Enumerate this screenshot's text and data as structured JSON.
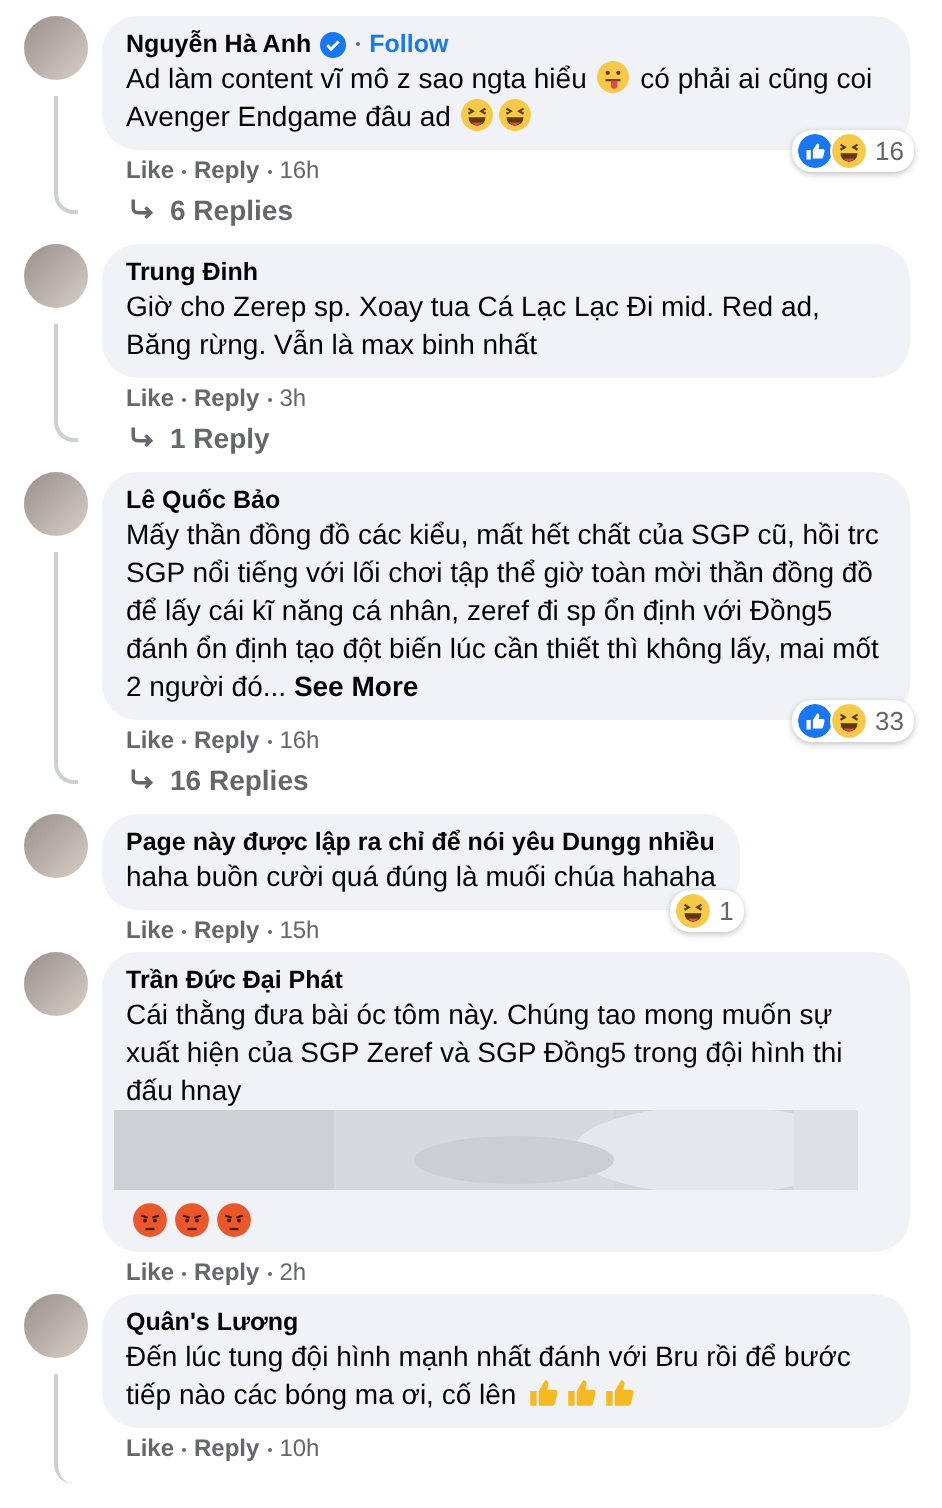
{
  "comments": [
    {
      "author": "Nguyễn Hà Anh",
      "verified": true,
      "follow": "Follow",
      "thread_line": true,
      "body": [
        {
          "kind": "text",
          "text": "Ad làm content vĩ mô z sao ngta hiểu "
        },
        {
          "kind": "tongue"
        },
        {
          "kind": "text",
          "text": " có phải ai cũng coi Avenger Endgame đâu ad "
        },
        {
          "kind": "laugh"
        },
        {
          "kind": "laugh"
        }
      ],
      "reactions": [
        {
          "kind": "like"
        },
        {
          "kind": "haha"
        }
      ],
      "reaction_count": "16",
      "like": "Like",
      "reply": "Reply",
      "time": "16h",
      "replies": "6 Replies"
    },
    {
      "author": "Trung Đinh",
      "thread_line": true,
      "body": [
        {
          "kind": "text",
          "text": "Giờ cho Zerep sp. Xoay tua Cá Lạc Lạc Đi mid. Red ad, Băng rừng. Vẫn là max binh nhất"
        }
      ],
      "like": "Like",
      "reply": "Reply",
      "time": "3h",
      "replies": "1 Reply"
    },
    {
      "author": "Lê Quốc Bảo",
      "thread_line": true,
      "body": [
        {
          "kind": "text",
          "text": "Mấy thần đồng đồ các kiểu, mất hết chất của SGP cũ, hồi trc SGP nổi tiếng với lối chơi tập thể giờ toàn mời thần đồng đồ để lấy cái kĩ năng cá nhân, zeref đi sp ổn định với Đồng5 đánh ổn định tạo đột biến lúc cần thiết thì không lấy, mai mốt 2 người đó... "
        },
        {
          "kind": "link",
          "text": "See More"
        }
      ],
      "reactions": [
        {
          "kind": "like"
        },
        {
          "kind": "haha"
        }
      ],
      "reaction_count": "33",
      "like": "Like",
      "reply": "Reply",
      "time": "16h",
      "replies": "16 Replies"
    },
    {
      "author": "Page này được lập ra chỉ để nói yêu Dungg nhiều",
      "thread_line": false,
      "body": [
        {
          "kind": "text",
          "text": "haha buồn cười quá đúng là muối chúa hahaha"
        }
      ],
      "reactions": [
        {
          "kind": "haha"
        }
      ],
      "reaction_count": "1",
      "like": "Like",
      "reply": "Reply",
      "time": "15h"
    },
    {
      "author": "Trần Đức Đại Phát",
      "thread_line": false,
      "body": [
        {
          "kind": "text",
          "text": "Cái thằng đưa bài óc tôm này. Chúng tao mong muốn sự xuất hiện của SGP Zeref và SGP Đồng5 trong đội hình thi đấu hnay"
        }
      ],
      "attachment": {
        "kind": "picture"
      },
      "after_attachment": [
        {
          "kind": "angry"
        },
        {
          "kind": "angry"
        },
        {
          "kind": "angry"
        }
      ],
      "like": "Like",
      "reply": "Reply",
      "time": "2h"
    },
    {
      "author": "Quân's Lương",
      "thread_line": true,
      "body": [
        {
          "kind": "text",
          "text": "Đến lúc tung đội hình mạnh nhất đánh với Bru rồi để bước tiếp nào các bóng ma ơi, cố lên "
        },
        {
          "kind": "thumb"
        },
        {
          "kind": "thumb"
        },
        {
          "kind": "thumb"
        }
      ],
      "like": "Like",
      "reply": "Reply",
      "time": "10h"
    }
  ]
}
